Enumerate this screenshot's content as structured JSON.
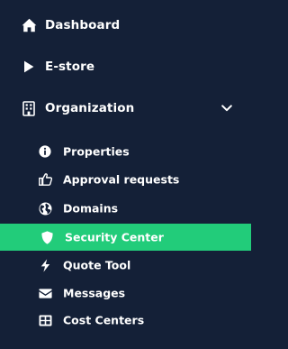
{
  "colors": {
    "background": "#142037",
    "active_background": "#22cc7a",
    "text": "#ffffff"
  },
  "nav": {
    "top_items": [
      {
        "label": "Dashboard",
        "icon": "home-icon"
      },
      {
        "label": "E-store",
        "icon": "play-icon"
      },
      {
        "label": "Organization",
        "icon": "building-icon",
        "expanded": true
      }
    ],
    "sub_items": [
      {
        "label": "Properties",
        "icon": "info-icon",
        "active": false
      },
      {
        "label": "Approval requests",
        "icon": "thumbs-up-icon",
        "active": false
      },
      {
        "label": "Domains",
        "icon": "globe-icon",
        "active": false
      },
      {
        "label": "Security Center",
        "icon": "shield-icon",
        "active": true
      },
      {
        "label": "Quote Tool",
        "icon": "bolt-icon",
        "active": false
      },
      {
        "label": "Messages",
        "icon": "envelope-icon",
        "active": false
      },
      {
        "label": "Cost Centers",
        "icon": "table-icon",
        "active": false
      }
    ]
  }
}
